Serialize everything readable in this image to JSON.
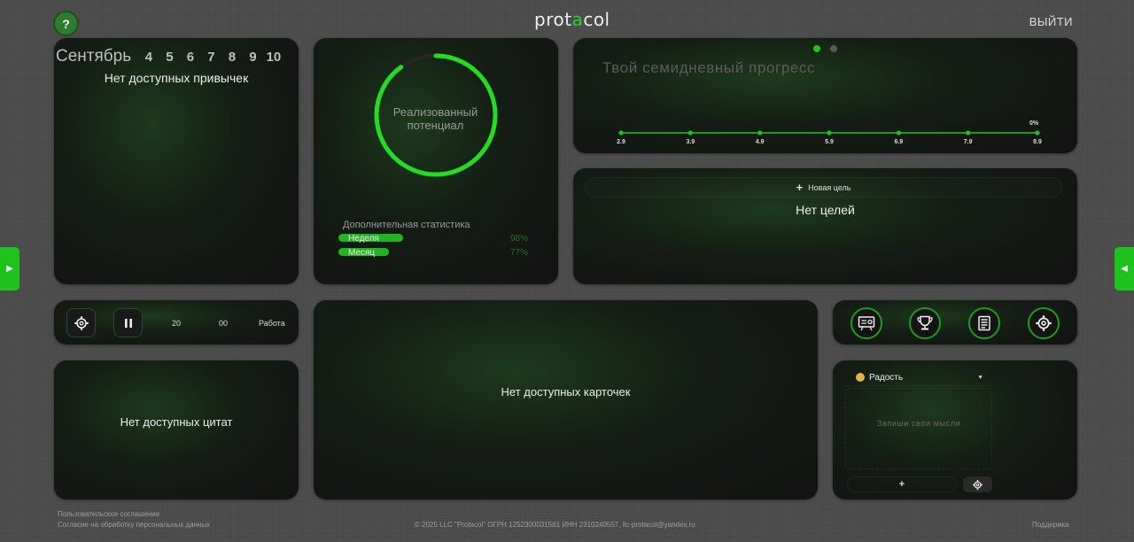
{
  "header": {
    "help_label": "?",
    "logo_before": "prot",
    "logo_accent": "a",
    "logo_after": "col",
    "logout_label": "ВЫЙТИ"
  },
  "side_tabs": {
    "left": "▶",
    "right": "◀"
  },
  "habits": {
    "month": "Сентябрь",
    "days": [
      "4",
      "5",
      "6",
      "7",
      "8",
      "9",
      "10"
    ],
    "empty_text": "Нет доступных привычек"
  },
  "potential": {
    "ring_label": "Реализованный потенциал",
    "ring_fraction": 1.0,
    "stats_title": "Дополнительная статистика",
    "stats": [
      {
        "label": "Неделя",
        "percent": 98,
        "percent_text": "98%"
      },
      {
        "label": "Месяц",
        "percent": 77,
        "percent_text": "77%"
      }
    ],
    "accent_color": "#22dd22"
  },
  "progress": {
    "title": "Твой семидневный прогресс",
    "page_indicators": [
      "active",
      "inactive"
    ]
  },
  "chart_data": {
    "type": "line",
    "title": "Твой семидневный прогресс",
    "categories": [
      "2.9",
      "3.9",
      "4.9",
      "5.9",
      "6.9",
      "7.9",
      "8.9"
    ],
    "series": [
      {
        "values": [
          0,
          0,
          0,
          0,
          0,
          0,
          0
        ]
      }
    ],
    "annotations": [
      {
        "x": "8.9",
        "text": "0%"
      }
    ],
    "grid": false,
    "color": "#1ec31e"
  },
  "goals": {
    "new_goal_icon": "+",
    "new_goal_label": "Новая цель",
    "empty_text": "Нет целей"
  },
  "timer": {
    "settings_icon": "gear-icon",
    "pause_icon": "pause-icon",
    "minutes": "20",
    "seconds": "00",
    "mode": "Работа"
  },
  "cards": {
    "empty_text": "Нет доступных карточек"
  },
  "quotes": {
    "empty_text": "Нет доступных цитат"
  },
  "icon_buttons": [
    "presentation-icon",
    "trophy-icon",
    "newspaper-icon",
    "gear-icon"
  ],
  "mood": {
    "selected": "Радость",
    "placeholder": "Запиши свои мысли",
    "add_label": "+",
    "settings_icon": "gear-icon"
  },
  "footer": {
    "terms": "Пользовательское соглашение",
    "consent": "Согласие на обработку персональных данных",
    "copyright": "© 2025 LLC \"Protacol\" ОГРН 1252300031581 ИНН 2310240557, llc-protacol@yandex.ru",
    "support": "Поддержка"
  }
}
